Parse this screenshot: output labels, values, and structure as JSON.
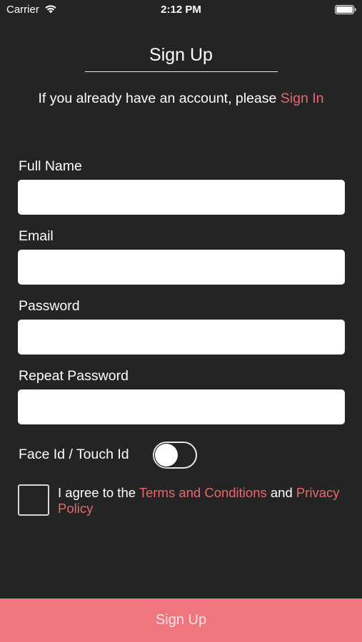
{
  "status_bar": {
    "carrier": "Carrier",
    "time": "2:12 PM",
    "wifi_icon": "wifi-icon",
    "battery_icon": "battery-icon"
  },
  "header": {
    "title": "Sign Up",
    "subtitle_prefix": "If you already have an account, please ",
    "sign_in_link": "Sign In"
  },
  "form": {
    "full_name": {
      "label": "Full Name",
      "value": ""
    },
    "email": {
      "label": "Email",
      "value": ""
    },
    "password": {
      "label": "Password",
      "value": ""
    },
    "repeat_password": {
      "label": "Repeat Password",
      "value": ""
    },
    "biometric": {
      "label": "Face Id / Touch Id",
      "enabled": false
    },
    "agree": {
      "checked": false,
      "text_1": "I agree to the ",
      "terms_link": "Terms and Conditions",
      "text_2": " and ",
      "privacy_link": "Privacy Policy"
    }
  },
  "footer": {
    "signup_button": "Sign Up"
  },
  "colors": {
    "background": "#242424",
    "accent": "#e8676f",
    "button": "#ef757e"
  }
}
